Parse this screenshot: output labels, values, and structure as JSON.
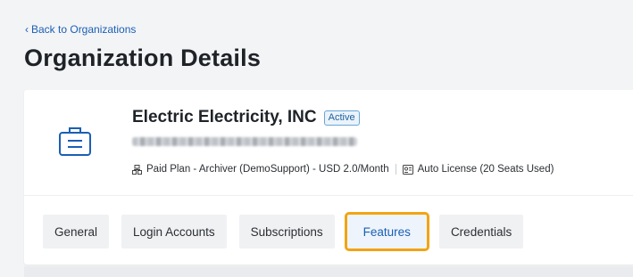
{
  "nav": {
    "back_label": "Back to Organizations"
  },
  "page": {
    "title": "Organization Details"
  },
  "organization": {
    "name": "Electric Electricity, INC",
    "status": "Active",
    "icon": "briefcase-icon",
    "plan": "Paid Plan - Archiver (DemoSupport) - USD 2.0/Month",
    "plan_icon": "plan-icon",
    "license": "Auto License (20 Seats Used)",
    "license_icon": "license-icon"
  },
  "tabs": [
    {
      "label": "General",
      "active": false
    },
    {
      "label": "Login Accounts",
      "active": false
    },
    {
      "label": "Subscriptions",
      "active": false
    },
    {
      "label": "Features",
      "active": true
    },
    {
      "label": "Credentials",
      "active": false
    }
  ],
  "colors": {
    "accent": "#1a5fb4",
    "highlight": "#f2a413",
    "status_border": "#6aa5d4"
  }
}
